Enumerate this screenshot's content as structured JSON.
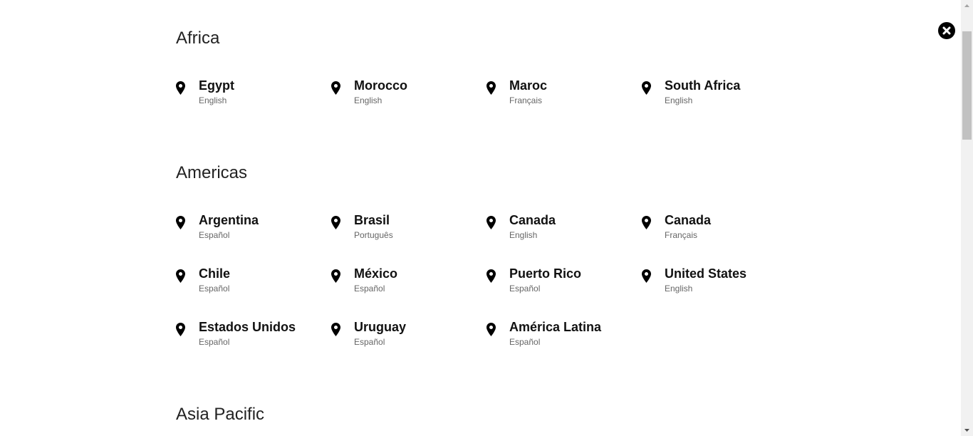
{
  "close": {
    "icon": "close-icon"
  },
  "regions": [
    {
      "title": "Africa",
      "countries": [
        {
          "name": "Egypt",
          "language": "English"
        },
        {
          "name": "Morocco",
          "language": "English"
        },
        {
          "name": "Maroc",
          "language": "Français"
        },
        {
          "name": "South Africa",
          "language": "English"
        }
      ]
    },
    {
      "title": "Americas",
      "countries": [
        {
          "name": "Argentina",
          "language": "Español"
        },
        {
          "name": "Brasil",
          "language": "Português"
        },
        {
          "name": "Canada",
          "language": "English"
        },
        {
          "name": "Canada",
          "language": "Français"
        },
        {
          "name": "Chile",
          "language": "Español"
        },
        {
          "name": "México",
          "language": "Español"
        },
        {
          "name": "Puerto Rico",
          "language": "Español"
        },
        {
          "name": "United States",
          "language": "English"
        },
        {
          "name": "Estados Unidos",
          "language": "Español"
        },
        {
          "name": "Uruguay",
          "language": "Español"
        },
        {
          "name": "América Latina",
          "language": "Español"
        }
      ]
    },
    {
      "title": "Asia Pacific",
      "countries": []
    }
  ],
  "colors": {
    "text": "#111111",
    "language": "#666666",
    "close_bg": "#000000",
    "scrollbar_track": "#f1f1f1",
    "scrollbar_thumb": "#c1c1c1"
  },
  "icons": {
    "country": "map-pin-icon"
  }
}
